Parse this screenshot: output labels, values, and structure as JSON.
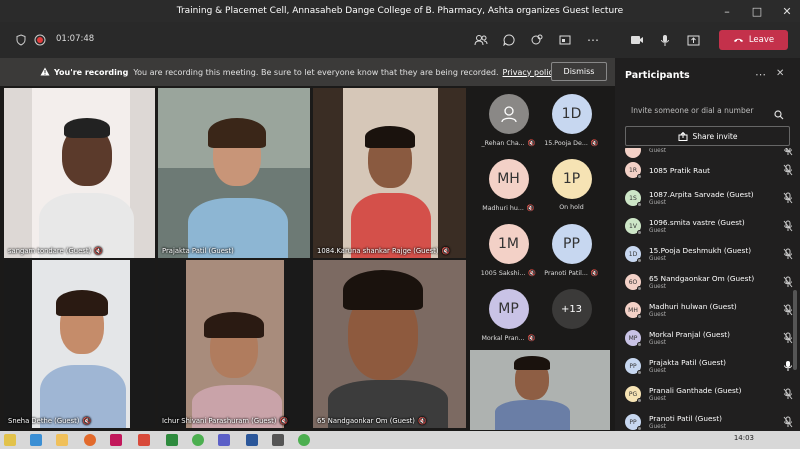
{
  "window": {
    "title": "Training & Placemet Cell, Annasaheb Dange College of B. Pharmacy, Ashta organizes Guest lecture"
  },
  "meeting": {
    "timer": "01:07:48",
    "leave_label": "Leave"
  },
  "banner": {
    "bold": "You're recording",
    "text": "You are recording this meeting. Be sure to let everyone know that they are being recorded.",
    "link": "Privacy policy",
    "dismiss_label": "Dismiss"
  },
  "video_tiles": [
    {
      "name": "sangam tondare (Guest)"
    },
    {
      "name": "Prajakta Patil (Guest)"
    },
    {
      "name": "1084.Karuna shankar Rajge (Guest)"
    },
    {
      "name": "Sneha Dethe (Guest)"
    },
    {
      "name": "Ichur Shivani Parashuram (Guest)"
    },
    {
      "name": "65 Nandgaonkar Om (Guest)"
    }
  ],
  "avatar_tiles": [
    {
      "initials": "",
      "label": "_Rehan Cha...",
      "color": "#8a8886"
    },
    {
      "initials": "1D",
      "label": "15.Pooja De...",
      "color": "#c7d7f0"
    },
    {
      "initials": "MH",
      "label": "Madhuri hu...",
      "color": "#f3d1c7"
    },
    {
      "initials": "1P",
      "label": "On hold",
      "color": "#f6e3b4"
    },
    {
      "initials": "1M",
      "label": "1005 Sakshi...",
      "color": "#f3d1c7"
    },
    {
      "initials": "PP",
      "label": "Pranoti Patil...",
      "color": "#c7d7f0"
    },
    {
      "initials": "MP",
      "label": "Morkal Pran...",
      "color": "#c9c3e6"
    },
    {
      "initials": "+13",
      "label": "",
      "color": "#3b3a39"
    }
  ],
  "panel": {
    "title": "Participants",
    "invite_placeholder": "Invite someone or dial a number",
    "share_label": "Share invite",
    "participants": [
      {
        "initials": "",
        "name": "",
        "role": "Guest",
        "color": "#f3d1c7"
      },
      {
        "initials": "1R",
        "name": "1085 Pratik Raut",
        "role": "",
        "color": "#f3d1c7"
      },
      {
        "initials": "1S",
        "name": "1087.Arpita Sarvade (Guest)",
        "role": "Guest",
        "color": "#cde6c7"
      },
      {
        "initials": "1V",
        "name": "1096.smita vastre (Guest)",
        "role": "Guest",
        "color": "#cde6c7"
      },
      {
        "initials": "1D",
        "name": "15.Pooja Deshmukh (Guest)",
        "role": "Guest",
        "color": "#c7d7f0"
      },
      {
        "initials": "6O",
        "name": "65 Nandgaonkar Om (Guest)",
        "role": "Guest",
        "color": "#f3d1c7"
      },
      {
        "initials": "MH",
        "name": "Madhuri hulwan (Guest)",
        "role": "Guest",
        "color": "#f3d1c7"
      },
      {
        "initials": "MP",
        "name": "Morkal Pranjal (Guest)",
        "role": "Guest",
        "color": "#c9c3e6"
      },
      {
        "initials": "PP",
        "name": "Prajakta Patil (Guest)",
        "role": "Guest",
        "color": "#c7d7f0"
      },
      {
        "initials": "PG",
        "name": "Pranali Ganthade (Guest)",
        "role": "Guest",
        "color": "#f6e3b4"
      },
      {
        "initials": "PP",
        "name": "Pranoti Patil (Guest)",
        "role": "Guest",
        "color": "#c7d7f0"
      }
    ]
  },
  "taskbar": {
    "time": "14:03"
  },
  "colors": {
    "leave": "#c4314b",
    "background": "#1f1f1f",
    "panel": "#201f1f"
  }
}
